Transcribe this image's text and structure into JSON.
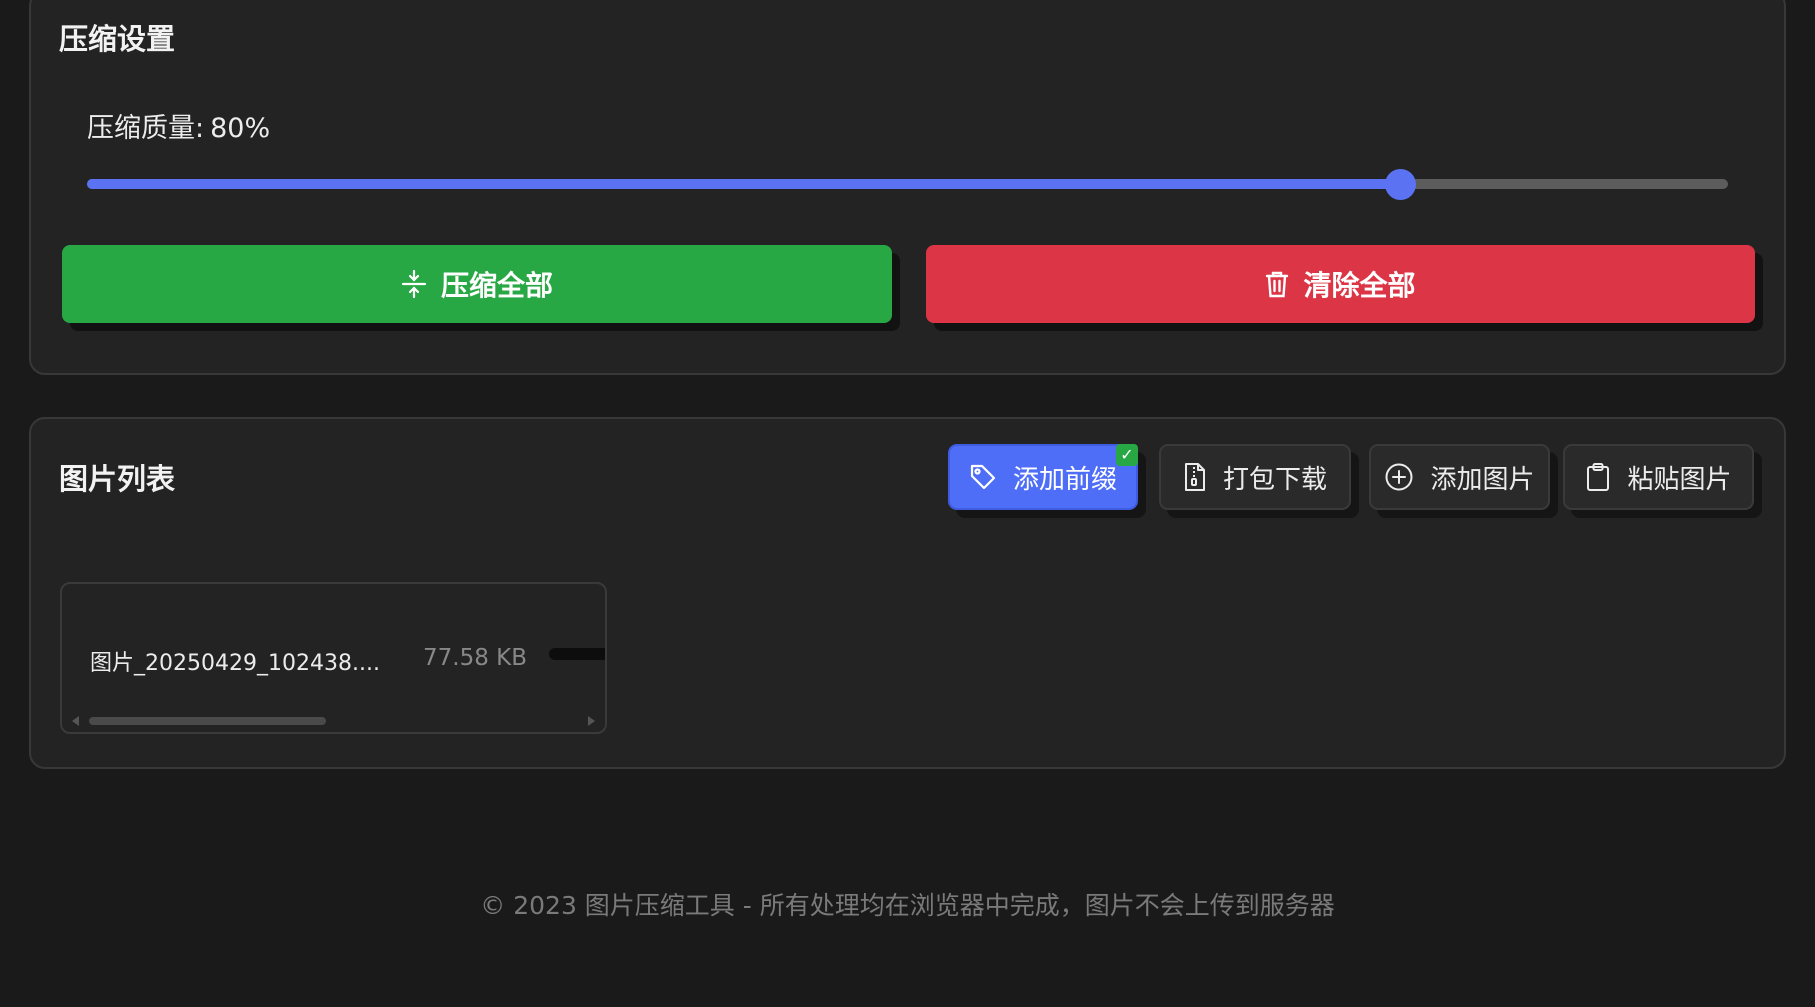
{
  "settings": {
    "title": "压缩设置",
    "quality_label": "压缩质量:",
    "quality_value": "80%",
    "quality": 80,
    "accent_color": "#5b73f2",
    "compress_all_label": "压缩全部",
    "clear_all_label": "清除全部",
    "compress_color": "#28a745",
    "clear_color": "#dc3545"
  },
  "image_list": {
    "title": "图片列表",
    "buttons": {
      "add_prefix": "添加前缀",
      "zip_download": "打包下载",
      "add_image": "添加图片",
      "paste_image": "粘贴图片"
    },
    "prefix_check": "✓",
    "files": [
      {
        "name": "图片_20250429_102438....",
        "size": "77.58 KB"
      }
    ]
  },
  "icons": {
    "compress": "compress-icon",
    "clear": "trash-icon",
    "prefix": "tag-icon",
    "zip": "zip-file-icon",
    "add": "plus-circle-icon",
    "paste": "clipboard-icon"
  },
  "footer": "© 2023 图片压缩工具 - 所有处理均在浏览器中完成，图片不会上传到服务器"
}
